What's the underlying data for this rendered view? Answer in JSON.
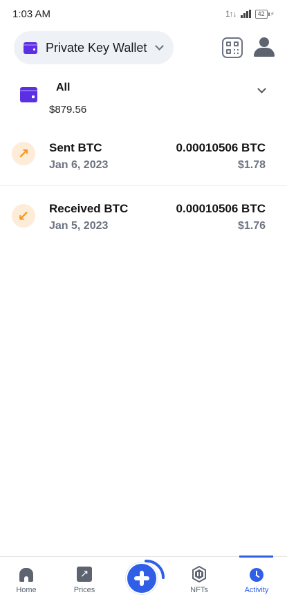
{
  "status_bar": {
    "time": "1:03 AM",
    "network": "1↑↓",
    "battery": "42"
  },
  "header": {
    "wallet_name": "Private Key Wallet",
    "wallet_icon": "wallet-icon",
    "qr_icon": "qr-code-icon",
    "profile_icon": "user-icon"
  },
  "account": {
    "name": "All",
    "balance": "$879.56"
  },
  "transactions": [
    {
      "title": "Sent BTC",
      "date": "Jan 6, 2023",
      "amount": "0.00010506 BTC",
      "fiat": "$1.78",
      "icon": "arrow-up-right-icon",
      "glyph": "↗"
    },
    {
      "title": "Received BTC",
      "date": "Jan 5, 2023",
      "amount": "0.00010506 BTC",
      "fiat": "$1.76",
      "icon": "arrow-down-left-icon",
      "glyph": "↙"
    }
  ],
  "tab_bar": {
    "tabs": [
      {
        "label": "Home",
        "icon": "home-icon"
      },
      {
        "label": "Prices",
        "icon": "chart-icon"
      },
      {
        "label": "NFTs",
        "icon": "nft-icon"
      },
      {
        "label": "Activity",
        "icon": "clock-icon",
        "active": true
      }
    ],
    "fab_icon": "plus-icon"
  },
  "colors": {
    "accent": "#2f5fe6",
    "wallet": "#5b2fe3",
    "tx_icon_bg": "#fdecd8",
    "tx_icon_fg": "#f39a1a"
  }
}
